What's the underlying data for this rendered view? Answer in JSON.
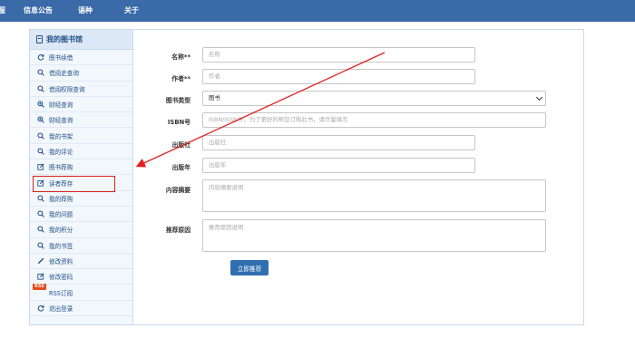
{
  "topnav": {
    "items": [
      "服",
      "信息公告",
      "语种",
      "关于"
    ]
  },
  "sidebar": {
    "title": "我的图书馆",
    "items": [
      {
        "label": "图书续借",
        "icon": "refresh-icon"
      },
      {
        "label": "借阅史查询",
        "icon": "search-icon"
      },
      {
        "label": "借阅权限查询",
        "icon": "search-icon"
      },
      {
        "label": "财经查询",
        "icon": "zoom-in-icon"
      },
      {
        "label": "财经查询",
        "icon": "zoom-in-icon"
      },
      {
        "label": "我的书架",
        "icon": "search-icon"
      },
      {
        "label": "我的评论",
        "icon": "search-icon"
      },
      {
        "label": "图书荐购",
        "icon": "edit-icon"
      },
      {
        "label": "读者荐存",
        "icon": "edit-icon"
      },
      {
        "label": "我的荐购",
        "icon": "search-icon"
      },
      {
        "label": "我的问题",
        "icon": "search-icon"
      },
      {
        "label": "我的积分",
        "icon": "search-icon"
      },
      {
        "label": "我的书签",
        "icon": "search-icon"
      },
      {
        "label": "修改资料",
        "icon": "pencil-icon"
      },
      {
        "label": "修改密码",
        "icon": "edit-icon"
      },
      {
        "label": "RSS订阅",
        "icon": "rss-icon",
        "badge": "RSS"
      },
      {
        "label": "退出登录",
        "icon": "refresh-icon"
      }
    ]
  },
  "form": {
    "title_label": "名称**",
    "title_placeholder": "名称",
    "author_label": "作者**",
    "author_placeholder": "作者",
    "type_label": "图书类型",
    "type_value": "图书",
    "isbn_label": "ISBN号",
    "isbn_placeholder": "ISBN/ISSN号，为了更好的帮您订购此书，请尽量填写",
    "publisher_label": "出版社",
    "publisher_placeholder": "出版社",
    "year_label": "出版年",
    "year_placeholder": "出版年",
    "summary_label": "内容摘要",
    "summary_placeholder": "内容摘要说明",
    "reason_label": "推荐原因",
    "reason_placeholder": "推荐原因说明",
    "submit_label": "立即推荐"
  },
  "colors": {
    "nav_bg": "#3a6aa8",
    "accent": "#2f6fb0",
    "annotation": "#e02020"
  }
}
